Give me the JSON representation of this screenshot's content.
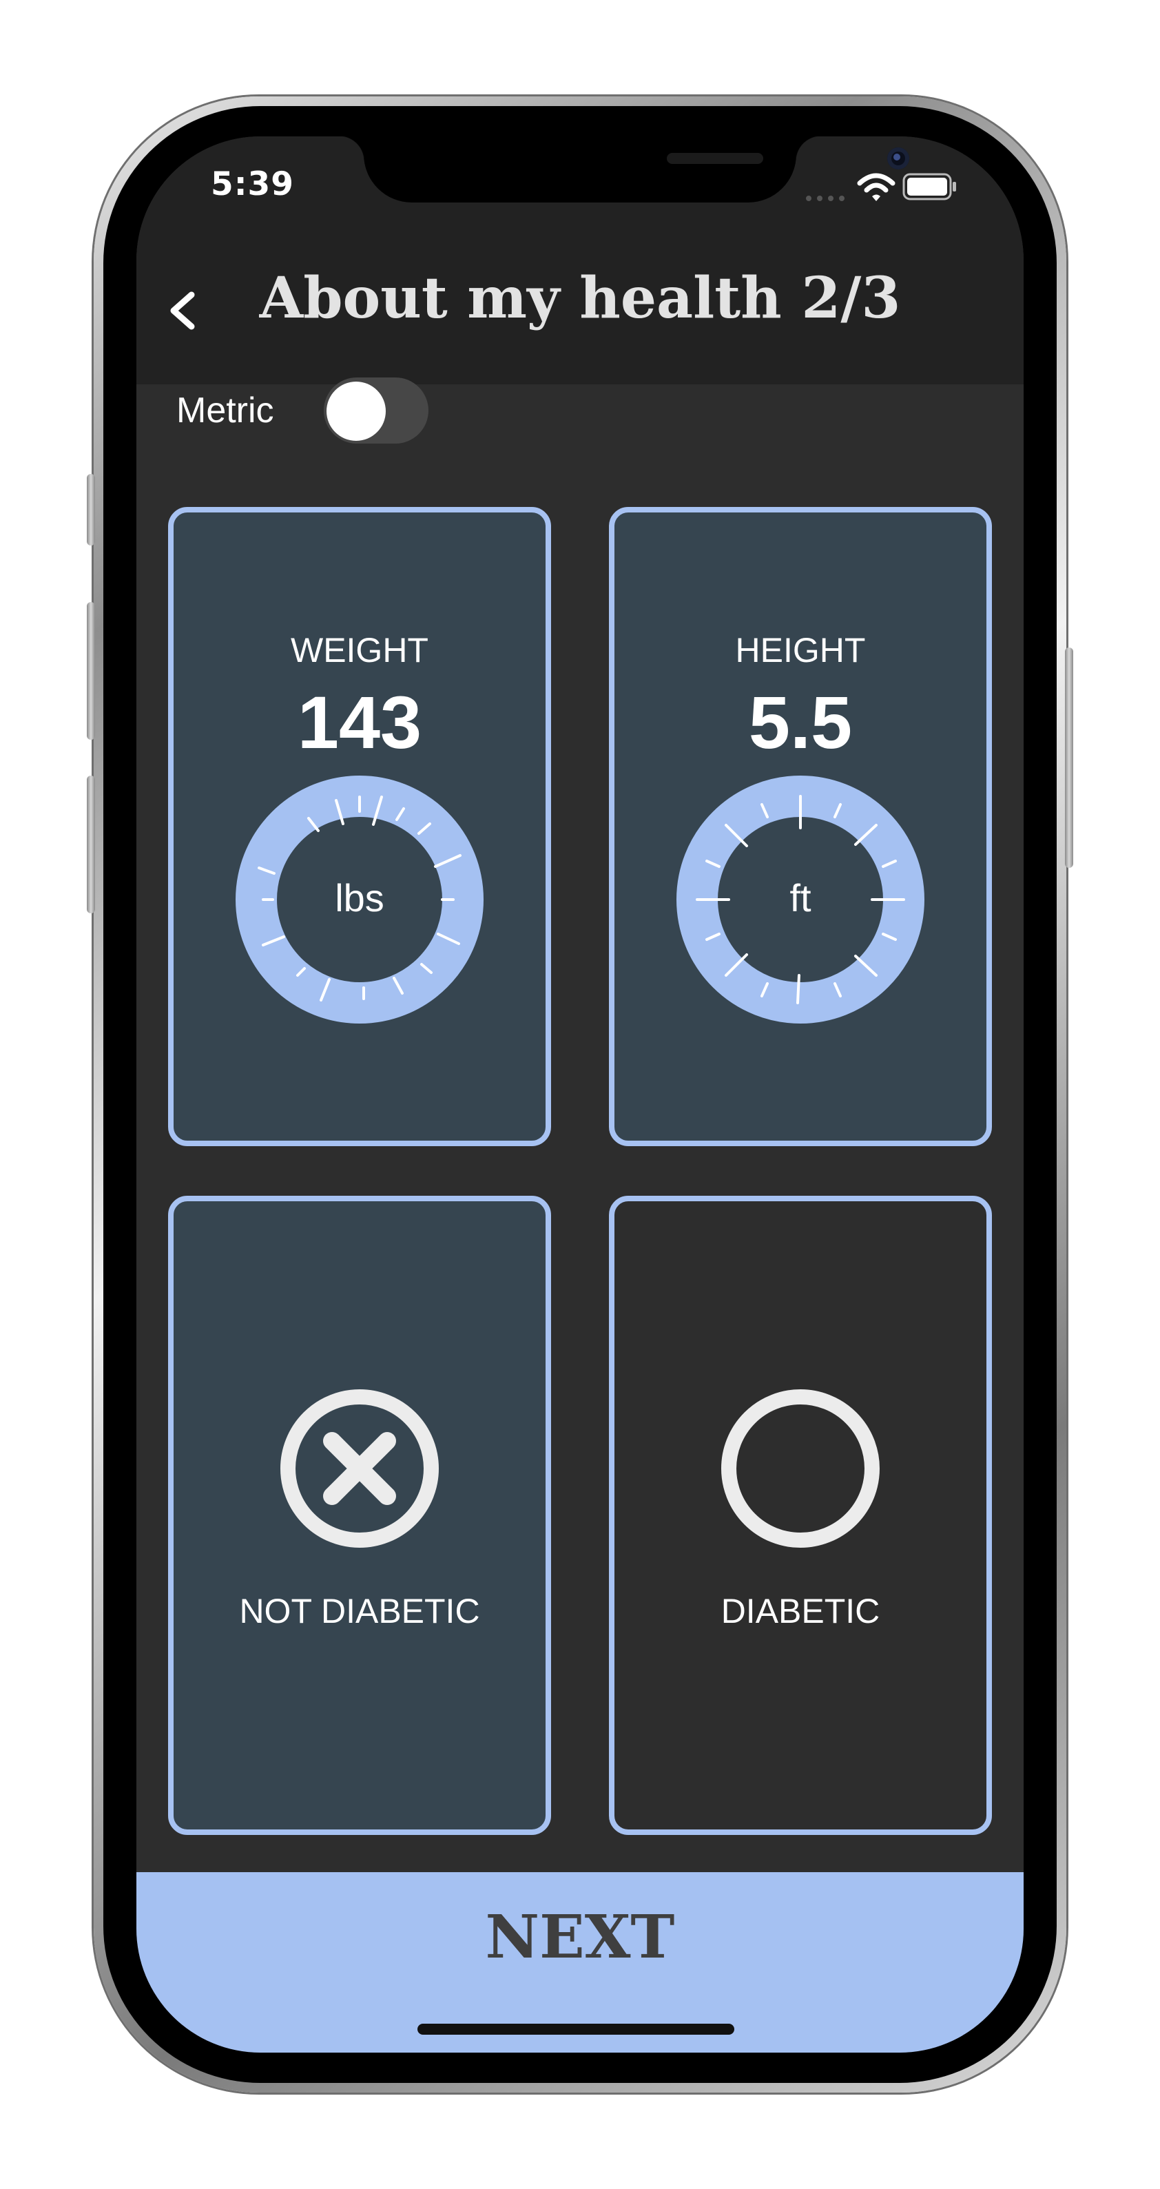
{
  "status_bar": {
    "time": "5:39"
  },
  "header": {
    "back_label": "<",
    "title": "About my health 2/3"
  },
  "units_toggle": {
    "label": "Metric",
    "on": false
  },
  "weight_card": {
    "label": "WEIGHT",
    "value": "143",
    "unit": "lbs",
    "selected": true
  },
  "height_card": {
    "label": "HEIGHT",
    "value": "5.5",
    "unit": "ft",
    "selected": true
  },
  "not_diabetic_card": {
    "label": "NOT DIABETIC",
    "selected": true
  },
  "diabetic_card": {
    "label": "DIABETIC",
    "selected": false
  },
  "next_button": {
    "label": "NEXT"
  },
  "colors": {
    "accent": "#a5c1f2",
    "card_selected_bg": "#364550",
    "screen_bg": "#2d2d2d",
    "header_bg": "#222222"
  }
}
